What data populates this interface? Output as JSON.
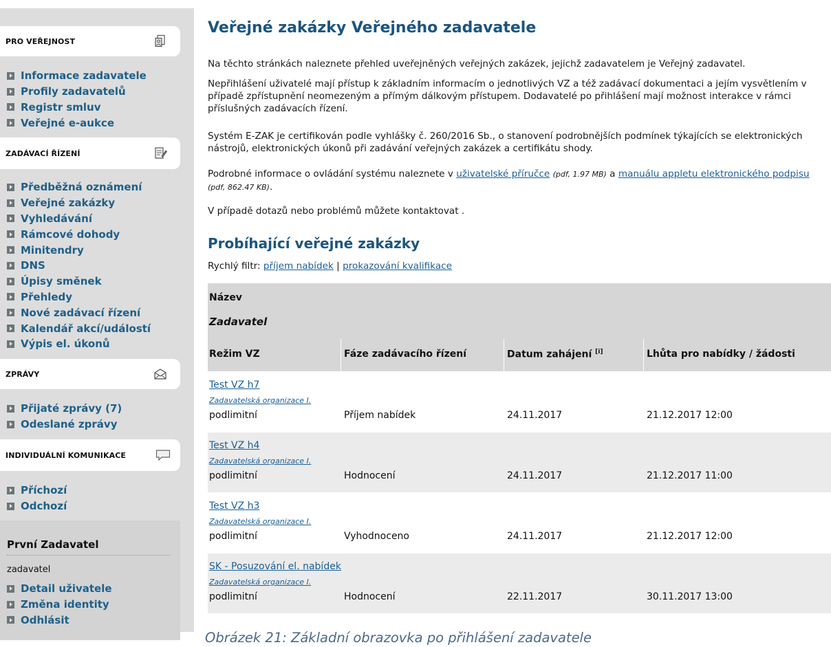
{
  "sidebar": {
    "sections": [
      {
        "title": "PRO VEŘEJNOST",
        "icon": "public-users-icon",
        "items": [
          "Informace zadavatele",
          "Profily zadavatelů",
          "Registr smluv",
          "Veřejné e-aukce"
        ]
      },
      {
        "title": "ZADÁVACÍ ŘÍZENÍ",
        "icon": "document-edit-icon",
        "items": [
          "Předběžná oznámení",
          "Veřejné zakázky",
          "Vyhledávání",
          "Rámcové dohody",
          "Minitendry",
          "DNS",
          "Úpisy směnek",
          "Přehledy",
          "Nové zadávací řízení",
          "Kalendář akcí/událostí",
          "Výpis el. úkonů"
        ]
      },
      {
        "title": "ZPRÁVY",
        "icon": "envelope-icon",
        "items": [
          "Přijaté zprávy (7)",
          "Odeslané zprávy"
        ]
      },
      {
        "title": "INDIVIDUÁLNÍ KOMUNIKACE",
        "icon": "speech-bubble-icon",
        "items": [
          "Příchozí",
          "Odchozí"
        ]
      }
    ],
    "user": {
      "name": "První Zadavatel",
      "role": "zadavatel",
      "items": [
        "Detail uživatele",
        "Změna identity",
        "Odhlásit"
      ]
    }
  },
  "main": {
    "title": "Veřejné zakázky Veřejného zadavatele",
    "p1": "Na těchto stránkách naleznete přehled uveřejněných veřejných zakázek, jejichž zadavatelem je Veřejný zadavatel.",
    "p2": "Nepřihlášení uživatelé mají přístup k základním informacím o jednotlivých VZ a též zadávací dokumentaci a jejím vysvětlením v případě zpřístupnění neomezeným a přímým dálkovým přístupem. Dodavatelé po přihlášení mají možnost interakce v rámci příslušných zadávacích řízení.",
    "p3": "Systém E-ZAK je certifikován podle vyhlášky č. 260/2016 Sb., o stanovení podrobnějších podmínek týkajících se elektronických nástrojů, elektronických úkonů při zadávání veřejných zakázek a certifikátu shody.",
    "p4": {
      "before": "Podrobné informace o ovládání systému naleznete v ",
      "link1": "uživatelské příručce",
      "meta1": "(pdf, 1.97 MB)",
      "mid": " a ",
      "link2": "manuálu appletu elektronického podpisu",
      "meta2": "(pdf, 862.47 KB)",
      "end": "."
    },
    "p5": "V případě dotazů nebo problémů můžete kontaktovat .",
    "section_title": "Probíhající veřejné zakázky",
    "quick_filter": {
      "label": "Rychlý filtr:",
      "link1": "příjem nabídek",
      "sep": "|",
      "link2": "prokazování kvalifikace"
    },
    "table": {
      "headers": {
        "name": "Název",
        "authority": "Zadavatel",
        "regime": "Režim VZ",
        "phase": "Fáze zadávacího řízení",
        "start": "Datum zahájení",
        "start_info": "[i]",
        "deadline": "Lhůta pro nabídky / žádosti"
      },
      "rows": [
        {
          "name": "Test VZ h7",
          "org": "Zadavatelská organizace I.",
          "regime": "podlimitní",
          "phase": "Příjem nabídek",
          "start": "24.11.2017",
          "deadline": "21.12.2017 12:00"
        },
        {
          "name": "Test VZ h4",
          "org": "Zadavatelská organizace I.",
          "regime": "podlimitní",
          "phase": "Hodnocení",
          "start": "24.11.2017",
          "deadline": "21.12.2017 11:00"
        },
        {
          "name": "Test VZ h3",
          "org": "Zadavatelská organizace I.",
          "regime": "podlimitní",
          "phase": "Vyhodnoceno",
          "start": "24.11.2017",
          "deadline": "21.12.2017 12:00"
        },
        {
          "name": "SK - Posuzování el. nabídek",
          "org": "Zadavatelská organizace I.",
          "regime": "podlimitní",
          "phase": "Hodnocení",
          "start": "22.11.2017",
          "deadline": "30.11.2017 13:00"
        }
      ]
    }
  },
  "caption": "Obrázek 21: Základní obrazovka po přihlášení zadavatele"
}
